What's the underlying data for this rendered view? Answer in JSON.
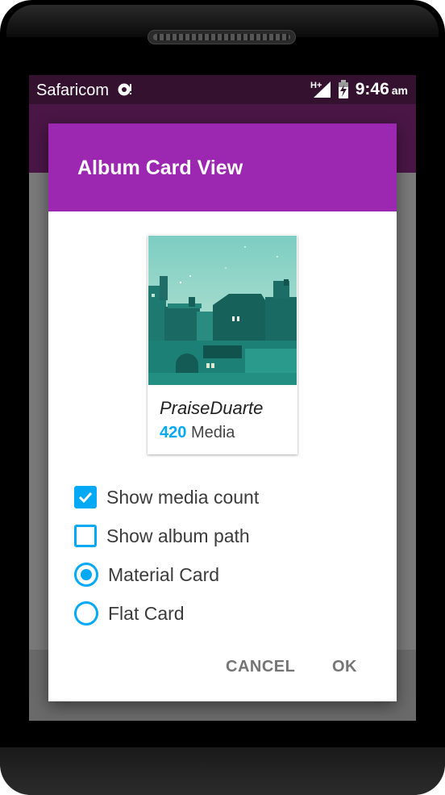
{
  "status_bar": {
    "carrier": "Safaricom",
    "network": "H+",
    "time": "9:46",
    "ampm": "am"
  },
  "dialog": {
    "title": "Album Card View",
    "card": {
      "album_name": "PraiseDuarte",
      "media_count": "420",
      "media_label": "Media"
    },
    "options": [
      {
        "label": "Show media count",
        "type": "checkbox",
        "checked": true
      },
      {
        "label": "Show album path",
        "type": "checkbox",
        "checked": false
      },
      {
        "label": "Material Card",
        "type": "radio",
        "checked": true
      },
      {
        "label": "Flat Card",
        "type": "radio",
        "checked": false
      }
    ],
    "buttons": {
      "cancel": "CANCEL",
      "ok": "OK"
    }
  },
  "colors": {
    "accent": "#03a9f4",
    "dialog_header": "#9c27b0",
    "status_bar": "#34122f"
  },
  "icons": [
    "carrier-badge-icon",
    "signal-hplus-icon",
    "battery-charging-icon",
    "checkbox-checked-icon",
    "checkbox-unchecked-icon",
    "radio-selected-icon",
    "radio-unselected-icon"
  ]
}
